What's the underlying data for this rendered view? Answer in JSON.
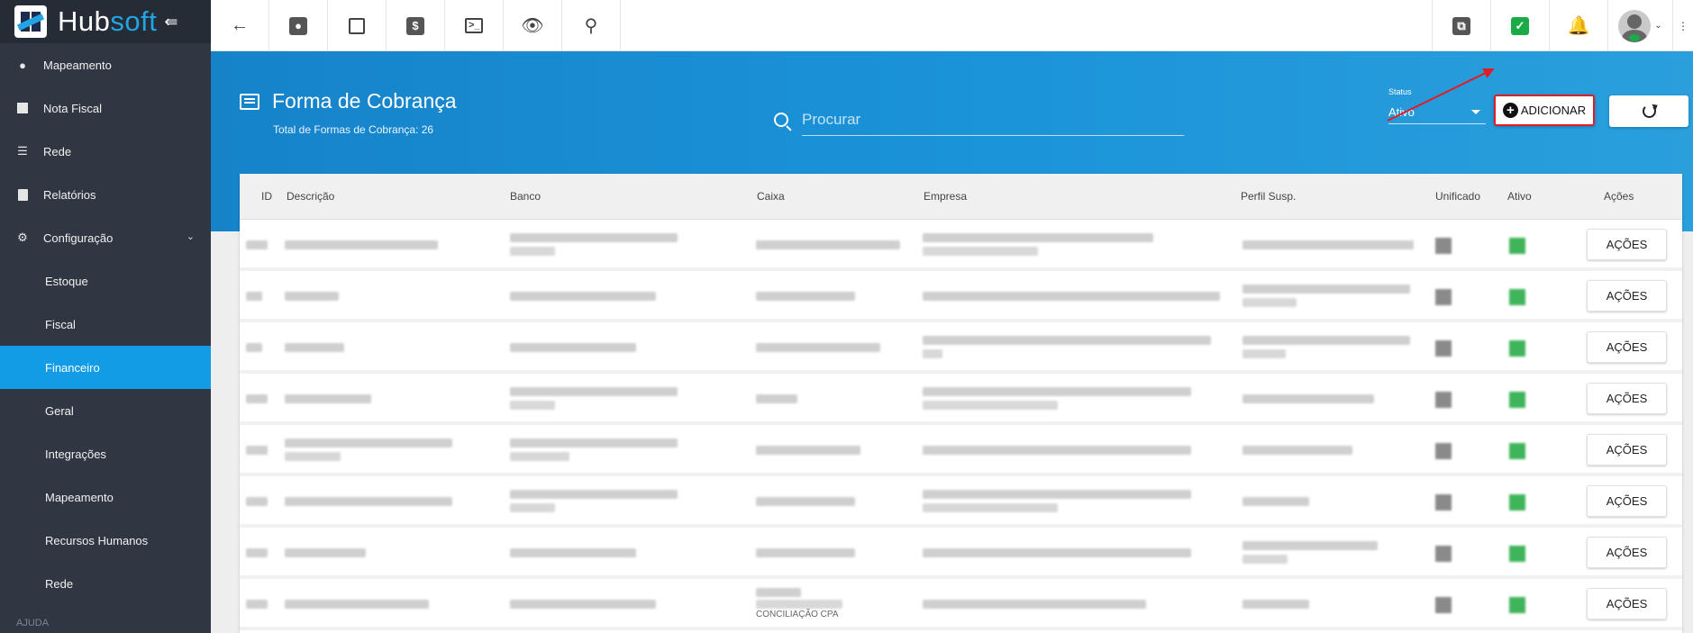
{
  "brand": {
    "name_part1": "Hub",
    "name_part2": "soft"
  },
  "sidebar": {
    "items": [
      {
        "label": "Mapeamento",
        "icon": "map-pin-icon"
      },
      {
        "label": "Nota Fiscal",
        "icon": "invoice-icon"
      },
      {
        "label": "Rede",
        "icon": "server-icon"
      },
      {
        "label": "Relatórios",
        "icon": "report-icon"
      },
      {
        "label": "Configuração",
        "icon": "gear-icon"
      }
    ],
    "subitems": [
      "Estoque",
      "Fiscal",
      "Financeiro",
      "Geral",
      "Integrações",
      "Mapeamento",
      "Recursos Humanos",
      "Rede"
    ],
    "active_subitem": "Financeiro",
    "section_label": "AJUDA"
  },
  "topbar": {
    "icons": [
      "back-arrow-icon",
      "contact-icon",
      "calendar-clock-icon",
      "dollar-icon",
      "terminal-icon",
      "eye-icon",
      "search-icon",
      "pdf-icon",
      "check-chat-icon",
      "bell-icon",
      "user-avatar-icon",
      "grid-dots-icon"
    ]
  },
  "header": {
    "title": "Forma de Cobrança",
    "subtitle": "Total de Formas de Cobrança: 26",
    "search_placeholder": "Procurar",
    "status_label": "Status",
    "status_value": "Ativo",
    "add_button": "ADICIONAR"
  },
  "table": {
    "columns": [
      "ID",
      "Descrição",
      "Banco",
      "Caixa",
      "Empresa",
      "Perfil Susp.",
      "Unificado",
      "Ativo",
      "Ações"
    ],
    "row_action_label": "AÇÕES",
    "visible_caixa_fragment": "CONCILIAÇÃO CPA",
    "row_count_visible": 8
  },
  "colors": {
    "accent": "#129ce5",
    "sidebar": "#303743",
    "highlight": "#e31c23",
    "active_green": "#1aab49"
  }
}
